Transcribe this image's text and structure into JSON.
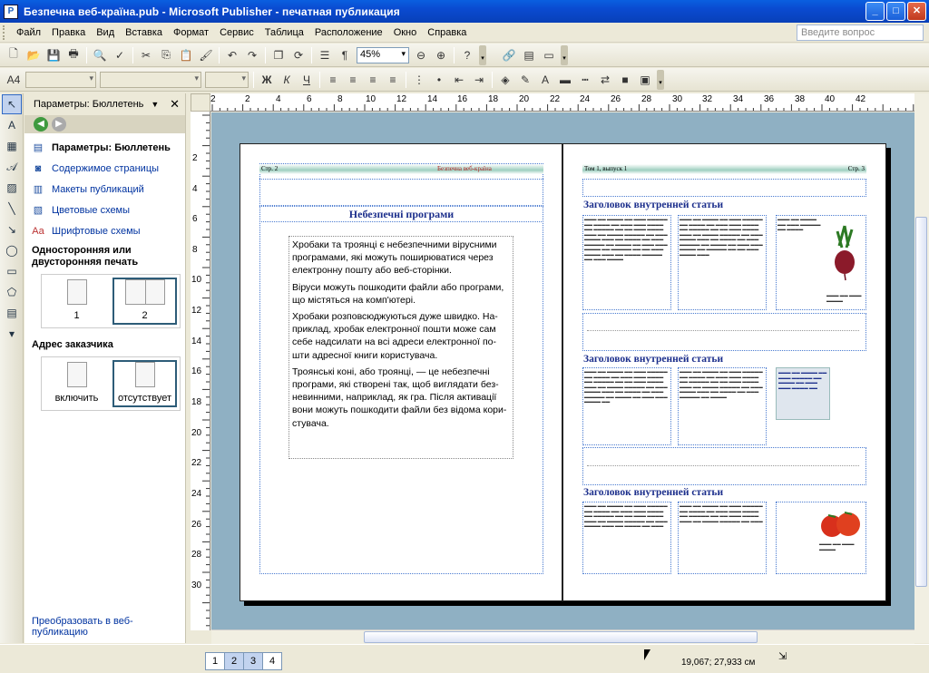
{
  "window": {
    "title": "Безпечна веб-країна.pub - Microsoft Publisher - печатная публикация"
  },
  "menu": {
    "items": [
      "Файл",
      "Правка",
      "Вид",
      "Вставка",
      "Формат",
      "Сервис",
      "Таблица",
      "Расположение",
      "Окно",
      "Справка"
    ],
    "ask_placeholder": "Введите вопрос"
  },
  "toolbar": {
    "zoom": "45%"
  },
  "taskpane": {
    "title": "Параметры: Бюллетень",
    "items": [
      {
        "label": "Параметры: Бюллетень",
        "icon": "newsletter-icon"
      },
      {
        "label": "Содержимое страницы",
        "icon": "page-content-icon"
      },
      {
        "label": "Макеты публикаций",
        "icon": "layouts-icon"
      },
      {
        "label": "Цветовые схемы",
        "icon": "color-schemes-icon"
      },
      {
        "label": "Шрифтовые схемы",
        "icon": "font-schemes-icon"
      }
    ],
    "print_section": "Односторонняя или двусторонняя печать",
    "print_options": [
      "1",
      "2"
    ],
    "address_section": "Адрес заказчика",
    "address_options": [
      "включить",
      "отсутствует"
    ],
    "bottom_link": "Преобразовать в веб-публикацию"
  },
  "ruler": {
    "h": [
      "2",
      "2",
      "4",
      "6",
      "8",
      "10",
      "12",
      "14",
      "16",
      "18",
      "20",
      "22",
      "24",
      "26",
      "28",
      "30",
      "32",
      "34",
      "36",
      "38",
      "40",
      "42"
    ],
    "v": [
      "2",
      "4",
      "6",
      "8",
      "10",
      "12",
      "14",
      "16",
      "18",
      "20",
      "22",
      "24",
      "26",
      "28",
      "30"
    ]
  },
  "left_page": {
    "page_num": "Стр. 2",
    "header_title": "Безпечна веб-країна",
    "article_title": "Небезпечні програми",
    "paragraphs": [
      "Хробаки та троянці є небезпечними вірусними програмами, які можуть поширюватися через електронну пошту або веб-сторінки.",
      "Віруси можуть пошкодити файли або програми, що містяться на комп'ютері.",
      "Хробаки розповсюджуються дуже швидко. На-приклад, хробак електронної пошти може сам себе надсилати на всі адреси електронної по-шти адресної книги користувача.",
      "Троянські коні, або троянці, — це небезпечні програми, які створені так, щоб виглядати без-невинними, наприклад, як гра. Після активації вони можуть пошкодити файли без відома кори-стувача."
    ]
  },
  "right_page": {
    "issue": "Том 1, выпуск 1",
    "page_num": "Стр. 3",
    "headings": [
      "Заголовок внутренней статьи",
      "Заголовок внутренней статьи",
      "Заголовок внутренней статьи"
    ]
  },
  "status": {
    "page_tabs": [
      "1",
      "2",
      "3",
      "4"
    ],
    "coords": "19,067; 27,933 см"
  }
}
